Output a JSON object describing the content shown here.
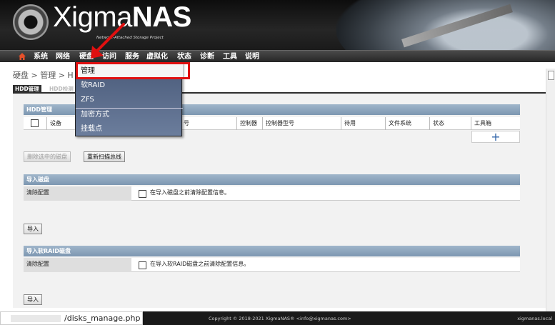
{
  "header": {
    "brand_main": "Xigma",
    "brand_bold": "NAS",
    "tagline": "Network-Attached Storage Project"
  },
  "nav": {
    "items": [
      "系统",
      "网络",
      "硬盘",
      "访问",
      "服务",
      "虚拟化",
      "状态",
      "诊断",
      "工具",
      "说明"
    ],
    "active": "硬盘"
  },
  "breadcrumb": "硬盘 > 管理 > H",
  "tabs": [
    "HDD管理",
    "HDD检测"
  ],
  "dropdown": {
    "items": [
      "管理",
      "软RAID",
      "ZFS",
      "加密方式",
      "挂载点"
    ]
  },
  "hdd_section": {
    "title": "HDD管理",
    "columns": [
      "设备",
      "号",
      "控制器",
      "控制器型号",
      "待用",
      "文件系统",
      "状态",
      "工具箱"
    ]
  },
  "buttons": {
    "delete_selected": "删除选中的磁盘",
    "rescan": "重新扫描总线",
    "import": "导入",
    "import_raid": "导入"
  },
  "import_disk": {
    "title": "导入磁盘",
    "label": "清除配置",
    "checkbox_text": "在导入磁盘之前清除配置信息。"
  },
  "import_raid": {
    "title": "导入软RAID磁盘",
    "label": "清除配置",
    "checkbox_text": "在导入软RAID磁盘之前清除配置信息。"
  },
  "footer": {
    "copyright": "Copyright © 2018-2021 XigmaNAS® <info@xigmanas.com>",
    "host": "xigmanas.local"
  },
  "statusbar": {
    "url": "/disks_manage.php"
  },
  "colors": {
    "accent_red": "#e01010",
    "section_header": "#8ea6bf",
    "nav_bg": "#333333"
  }
}
